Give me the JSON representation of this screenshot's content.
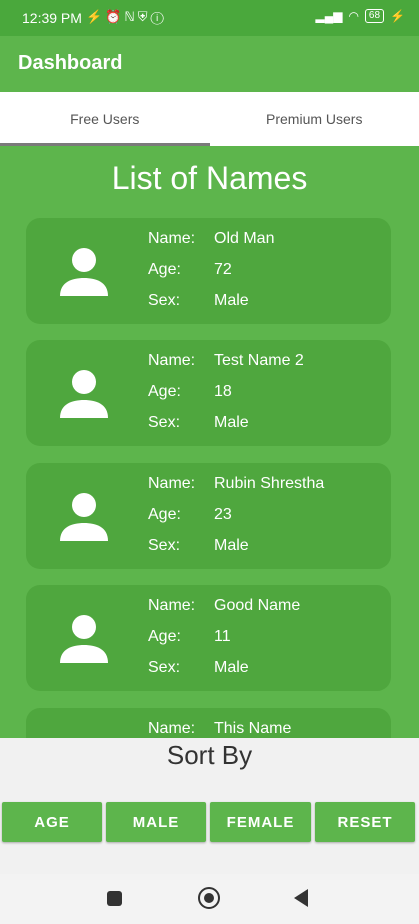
{
  "status_bar": {
    "time": "12:39 PM",
    "left_icons": "⚡⏰ℕ⛨ⓘ",
    "battery": "68"
  },
  "app_bar": {
    "title": "Dashboard"
  },
  "tabs": [
    {
      "label": "Free Users",
      "active": true
    },
    {
      "label": "Premium Users",
      "active": false
    }
  ],
  "list": {
    "title": "List of Names",
    "labels": {
      "name": "Name:",
      "age": "Age:",
      "sex": "Sex:"
    },
    "users": [
      {
        "name": "Old Man",
        "age": "72",
        "sex": "Male"
      },
      {
        "name": "Test Name 2",
        "age": "18",
        "sex": "Male"
      },
      {
        "name": "Rubin Shrestha",
        "age": "23",
        "sex": "Male"
      },
      {
        "name": "Good Name",
        "age": "11",
        "sex": "Male"
      },
      {
        "name": "This Name",
        "age": "",
        "sex": ""
      }
    ]
  },
  "sort": {
    "title": "Sort By",
    "buttons": [
      "AGE",
      "MALE",
      "FEMALE",
      "RESET"
    ]
  },
  "colors": {
    "primary": "#5db54c",
    "card": "#4fa73e"
  }
}
